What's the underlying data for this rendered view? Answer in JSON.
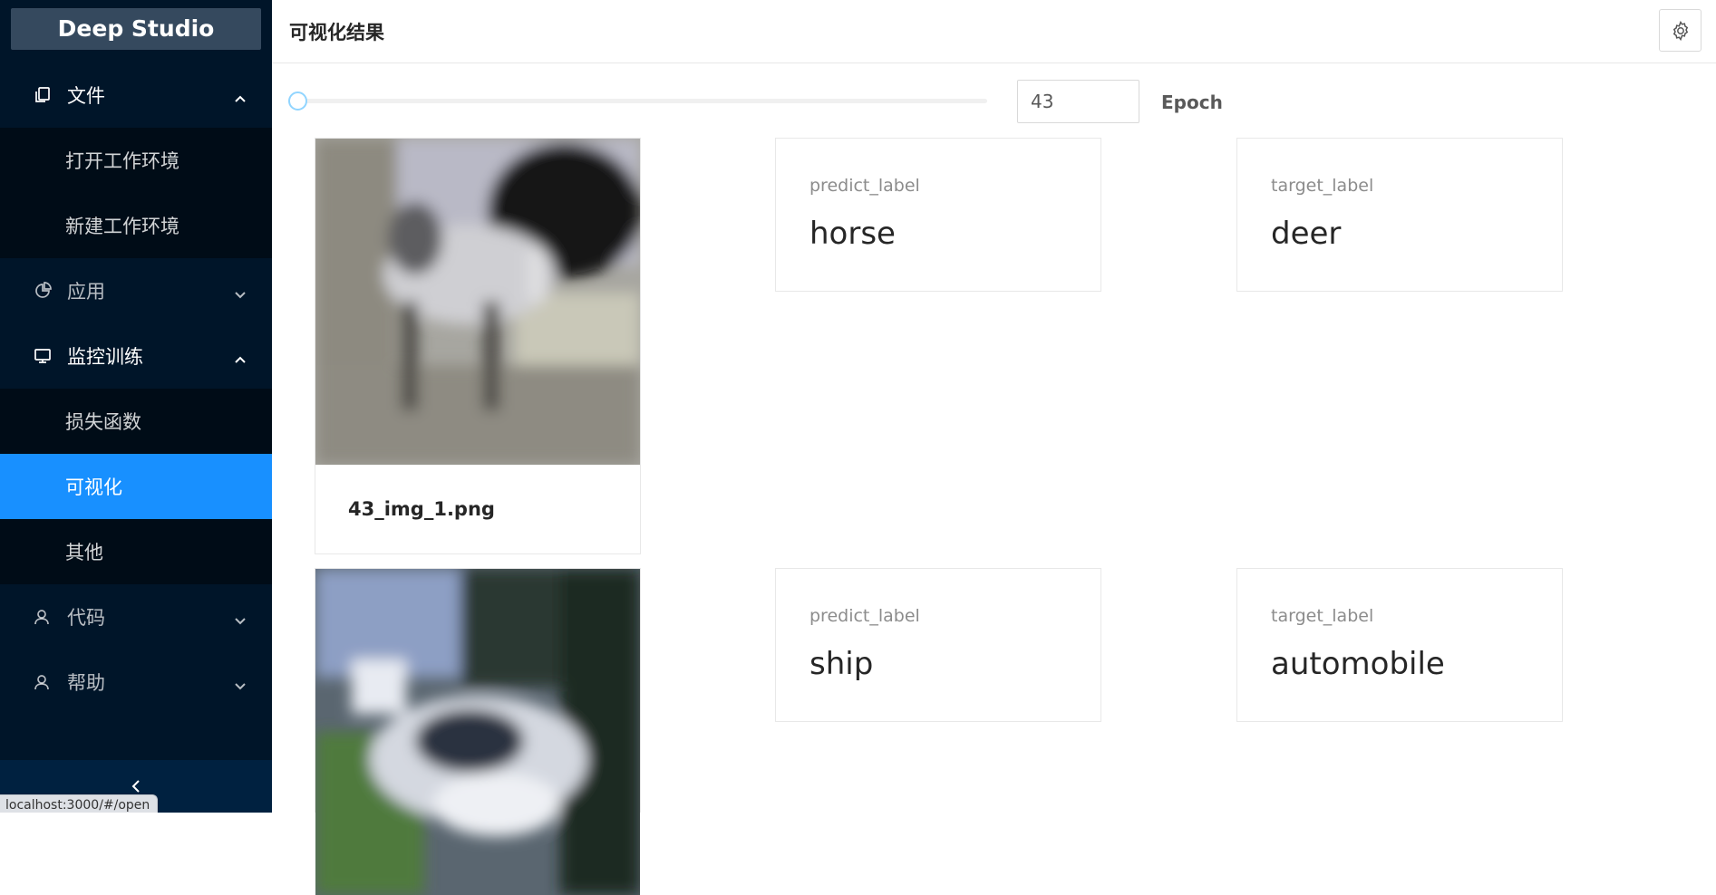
{
  "app": {
    "name": "Deep Studio"
  },
  "sidebar": {
    "menus": [
      {
        "label": "文件",
        "icon": "copy-icon",
        "open": true,
        "children": [
          {
            "label": "打开工作环境"
          },
          {
            "label": "新建工作环境"
          }
        ]
      },
      {
        "label": "应用",
        "icon": "pie-chart-icon",
        "open": false
      },
      {
        "label": "监控训练",
        "icon": "desktop-icon",
        "open": true,
        "children": [
          {
            "label": "损失函数"
          },
          {
            "label": "可视化",
            "selected": true
          },
          {
            "label": "其他"
          }
        ]
      },
      {
        "label": "代码",
        "icon": "user-icon",
        "open": false
      },
      {
        "label": "帮助",
        "icon": "user-icon",
        "open": false
      }
    ],
    "collapse_icon": "left-chevron-icon"
  },
  "status_bar": {
    "url": "localhost:3000/#/open"
  },
  "header": {
    "title": "可视化结果",
    "settings_icon": "gear-icon"
  },
  "epoch_control": {
    "value": "43",
    "label": "Epoch",
    "slider_fraction": 0.0
  },
  "results": [
    {
      "filename": "43_img_1.png",
      "image": "horse-photo",
      "predict": {
        "title": "predict_label",
        "value": "horse"
      },
      "target": {
        "title": "target_label",
        "value": "deer"
      }
    },
    {
      "filename": "",
      "image": "car-photo",
      "predict": {
        "title": "predict_label",
        "value": "ship"
      },
      "target": {
        "title": "target_label",
        "value": "automobile"
      }
    }
  ],
  "colors": {
    "sidebar_bg": "#001529",
    "submenu_bg": "#000c17",
    "selected": "#1890ff",
    "logo_bg": "#35495e"
  }
}
